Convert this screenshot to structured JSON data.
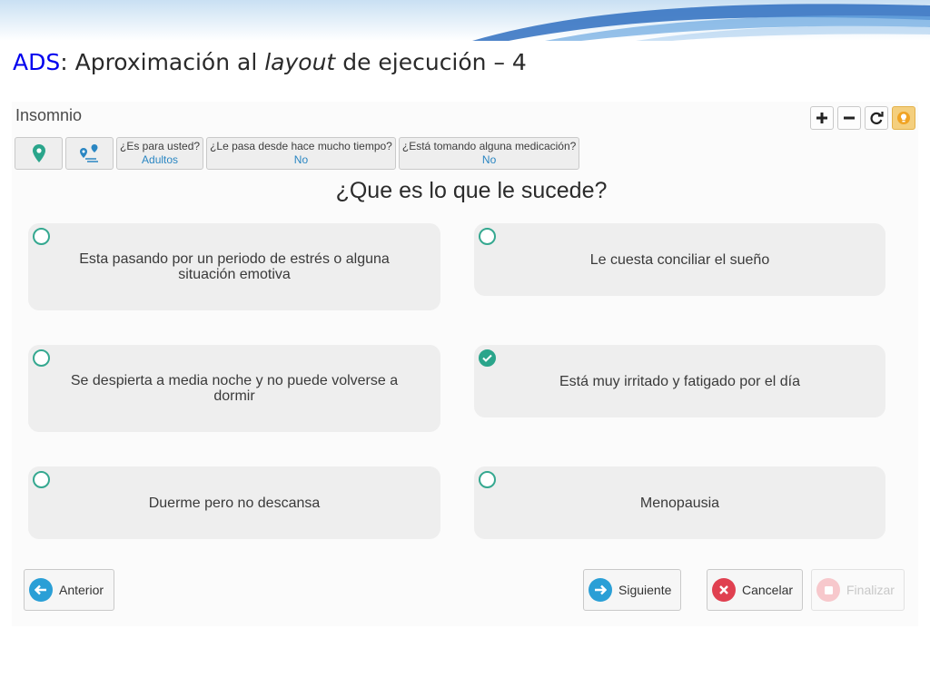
{
  "slide": {
    "title_prefix": "ADS",
    "title_middle": ": Aproximación al ",
    "title_italic": "layout",
    "title_suffix": " de ejecución – 4"
  },
  "app": {
    "title": "Insomnio",
    "toolbar": {
      "icons": [
        "plus-icon",
        "minus-icon",
        "refresh-icon",
        "lightbulb-icon"
      ],
      "accent_color": "#f4cf7e"
    },
    "filters": {
      "icons": [
        "location-pin-icon",
        "route-icon"
      ],
      "items": [
        {
          "question": "¿Es para usted?",
          "answer": "Adultos"
        },
        {
          "question": "¿Le pasa desde hace mucho tiempo?",
          "answer": "No"
        },
        {
          "question": "¿Está tomando alguna medicación?",
          "answer": "No"
        }
      ]
    },
    "question": "¿Que es lo que le sucede?",
    "options": [
      {
        "text": "Esta pasando por un periodo de estrés o alguna situación emotiva",
        "selected": false
      },
      {
        "text": "Le cuesta conciliar el sueño",
        "selected": false
      },
      {
        "text": "Se despierta a media noche y no puede volverse a dormir",
        "selected": false
      },
      {
        "text": "Está muy irritado y fatigado por el día",
        "selected": true
      },
      {
        "text": "Duerme pero no descansa",
        "selected": false
      },
      {
        "text": "Menopausia",
        "selected": false
      }
    ],
    "buttons": {
      "previous": "Anterior",
      "next": "Siguiente",
      "cancel": "Cancelar",
      "finish": "Finalizar"
    },
    "colors": {
      "primary": "#2a9fd6",
      "danger": "#e04050",
      "check": "#2aa58b"
    }
  }
}
